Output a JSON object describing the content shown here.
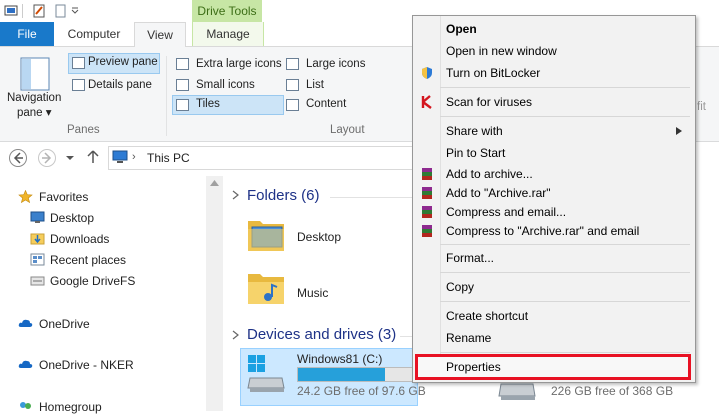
{
  "ribbon": {
    "tabs": {
      "file": "File",
      "computer": "Computer",
      "view": "View",
      "manage": "Manage"
    },
    "contextual_tab": "Drive Tools",
    "navigation_pane_line1": "Navigation",
    "navigation_pane_line2": "pane ▾",
    "preview_pane": "Preview pane",
    "details_pane": "Details pane",
    "panes_group": "Panes",
    "layout": {
      "extra_large_icons": "Extra large icons",
      "large_icons": "Large icons",
      "small_icons": "Small icons",
      "list": "List",
      "tiles": "Tiles",
      "content": "Content"
    },
    "layout_group": "Layout",
    "partial_right": "fit"
  },
  "address": {
    "location": "This PC"
  },
  "nav_pane": {
    "favorites": "Favorites",
    "desktop": "Desktop",
    "downloads": "Downloads",
    "recent_places": "Recent places",
    "google_drivefs": "Google DriveFS",
    "onedrive": "OneDrive",
    "onedrive_nker": "OneDrive - NKER",
    "homegroup": "Homegroup"
  },
  "content": {
    "folders_header": "Folders (6)",
    "folders": [
      "Desktop",
      "Music"
    ],
    "devices_header": "Devices and drives (3)",
    "drive_c_name": "Windows81 (C:)",
    "drive_c_free": "24.2 GB free of 97.6 GB",
    "drive_c_used_fraction": 0.75,
    "drive_2_free": "226 GB free of 368 GB"
  },
  "context_menu": {
    "open": "Open",
    "open_new_window": "Open in new window",
    "bitlocker": "Turn on BitLocker",
    "scan": "Scan for viruses",
    "share_with": "Share with",
    "pin_to_start": "Pin to Start",
    "add_archive": "Add to archive...",
    "add_archive_rar": "Add to \"Archive.rar\"",
    "compress_email": "Compress and email...",
    "compress_rar_email": "Compress to \"Archive.rar\" and email",
    "format": "Format...",
    "copy": "Copy",
    "create_shortcut": "Create shortcut",
    "rename": "Rename",
    "properties": "Properties"
  },
  "colors": {
    "accent": "#1979ca",
    "highlight": "#e81123",
    "drive_tools": "#c7e6a5"
  }
}
